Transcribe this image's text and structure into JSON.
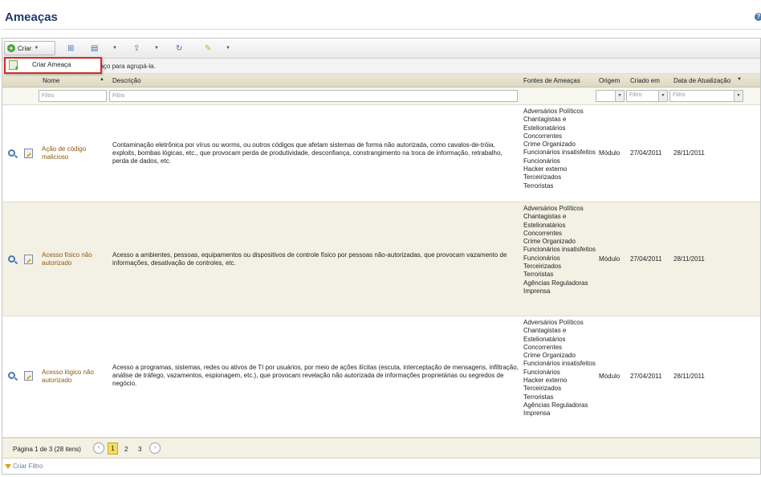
{
  "page": {
    "title": "Ameaças"
  },
  "toolbar": {
    "create_label": "Criar"
  },
  "dropdown": {
    "create_threat_label": "Criar Ameaça"
  },
  "group_bar": {
    "text": "paço para agrupá-la."
  },
  "columns": {
    "nome": "Nome",
    "descricao": "Descrição",
    "fontes": "Fontes de Ameaças",
    "origem": "Origem",
    "criado": "Criado em",
    "atualizacao": "Data de Atualização"
  },
  "filters": {
    "placeholder": "Filtro"
  },
  "rows": [
    {
      "name": "Ação de código malicioso",
      "description": "Contaminação eletrônica por vírus ou worms, ou outros códigos que afetam sistemas de forma não autorizada, como cavalos-de-tróia, exploits, bombas lógicas, etc., que provocam perda de produtividade, desconfiança, constrangimento na troca de informação, retrabalho, perda de dados, etc.",
      "sources": "Adversários Políticos\nChantagistas e Estelionatários\nConcorrentes\nCrime Organizado\nFuncionários insatisfeitos\nFuncionários\nHacker externo\nTerceirizados\nTerroristas",
      "origin": "Módulo",
      "created": "27/04/2011",
      "updated": "28/11/2011"
    },
    {
      "name": "Acesso físico não autorizado",
      "description": "Acesso a ambientes, pessoas, equipamentos ou dispositivos de controle físico por pessoas não-autorizadas, que provocam vazamento de informações, desativação de controles, etc.",
      "sources": "Adversários Políticos\nChantagistas e Estelionatários\nConcorrentes\nCrime Organizado\nFuncionários insatisfeitos\nFuncionários\nTerceirizados\nTerroristas\nAgências Reguladoras\nImprensa",
      "origin": "Módulo",
      "created": "27/04/2011",
      "updated": "28/11/2011"
    },
    {
      "name": "Acesso lógico não autorizado",
      "description": "Acesso a programas, sistemas, redes ou ativos de TI por usuários, por meio de ações ilícitas (escuta, interceptação de mensagens, infiltração, análise de tráfego, vazamentos, espionagem, etc.), que provocam revelação não autorizada de informações proprietárias ou segredos de negócio.",
      "sources": "Adversários Políticos\nChantagistas e Estelionatários\nConcorrentes\nCrime Organizado\nFuncionários insatisfeitos\nFuncionários\nHacker externo\nTerceirizados\nTerroristas\nAgências Reguladoras\nImprensa",
      "origin": "Módulo",
      "created": "27/04/2011",
      "updated": "28/11/2011"
    }
  ],
  "pager": {
    "label": "Página 1 de 3 (28 itens)",
    "prev": "‹",
    "next": "›",
    "pages": [
      "1",
      "2",
      "3"
    ]
  },
  "footer": {
    "create_filter": "Criar Filtro"
  }
}
